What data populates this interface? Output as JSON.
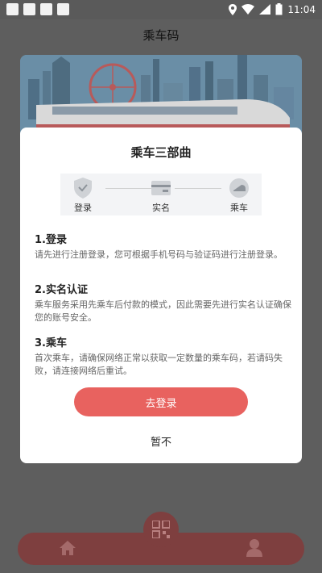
{
  "status_bar": {
    "time": "11:04"
  },
  "app_bar": {
    "title": "乘车码"
  },
  "dialog": {
    "title": "乘车三部曲",
    "steps": [
      {
        "label": "登录",
        "icon": "shield-check-icon"
      },
      {
        "label": "实名",
        "icon": "id-card-icon"
      },
      {
        "label": "乘车",
        "icon": "train-icon"
      }
    ],
    "sections": [
      {
        "title": "1.登录",
        "text": "请先进行注册登录，您可根据手机号码与验证码进行注册登录。"
      },
      {
        "title": "2.实名认证",
        "text": "乘车服务采用先乘车后付款的模式，因此需要先进行实名认证确保您的账号安全。"
      },
      {
        "title": "3.乘车",
        "text": "首次乘车，请确保网络正常以获取一定数量的乘车码，若请码失败，请连接网络后重试。"
      }
    ],
    "login_button": "去登录",
    "later_button": "暂不"
  },
  "colors": {
    "accent": "#e8625f",
    "overlay": "#5e5e5e",
    "bottom_bar": "#7e3f3f"
  }
}
